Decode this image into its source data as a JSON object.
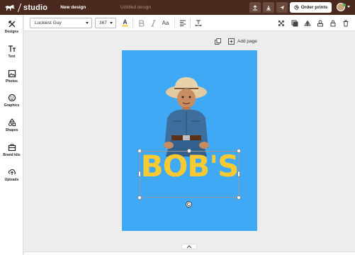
{
  "topbar": {
    "logo_text": "studio",
    "menu_label": "New design",
    "doc_title": "Untitled design",
    "order_label": "Order prints"
  },
  "sidebar": {
    "items": [
      {
        "label": "Designs",
        "icon": "designs-icon"
      },
      {
        "label": "Text",
        "icon": "text-icon"
      },
      {
        "label": "Photos",
        "icon": "photos-icon"
      },
      {
        "label": "Graphics",
        "icon": "graphics-icon"
      },
      {
        "label": "Shapes",
        "icon": "shapes-icon"
      },
      {
        "label": "Brand kits",
        "icon": "brand-kits-icon"
      },
      {
        "label": "Uploads",
        "icon": "uploads-icon"
      }
    ]
  },
  "toolbar": {
    "font_name": "Luckiest Guy",
    "font_size": "367",
    "case_label": "Aa"
  },
  "canvas": {
    "add_page_label": "Add page",
    "design_text": "BOB'S",
    "background_color": "#3fa9f5",
    "text_color": "#f7c932"
  },
  "colors": {
    "topbar": "#4a2a1f",
    "accent_green": "#4caf50"
  }
}
